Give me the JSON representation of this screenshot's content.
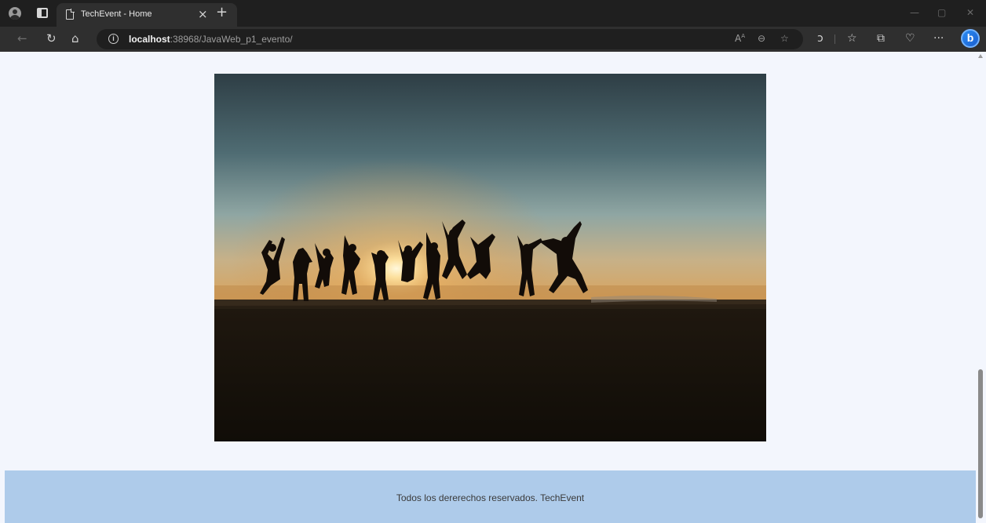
{
  "browser": {
    "tab_title": "TechEvent - Home",
    "tab_close": "×",
    "new_tab": "+",
    "url_host": "localhost",
    "url_rest": ":38968/JavaWeb_p1_evento/",
    "read_aloud": "A̅",
    "win_minimize": "—",
    "win_restore": "▢",
    "win_close": "✕",
    "more": "···",
    "bing": "b"
  },
  "hero_image": {
    "description_icon": "people-jumping-at-sunset-photo"
  },
  "footer": {
    "text": "Todos los dererechos reservados. TechEvent"
  },
  "colors": {
    "page_bg": "#f3f6fd",
    "footer_bg": "#aecbea",
    "chrome_dark": "#1f1f1f",
    "toolbar": "#2f2f2f"
  }
}
